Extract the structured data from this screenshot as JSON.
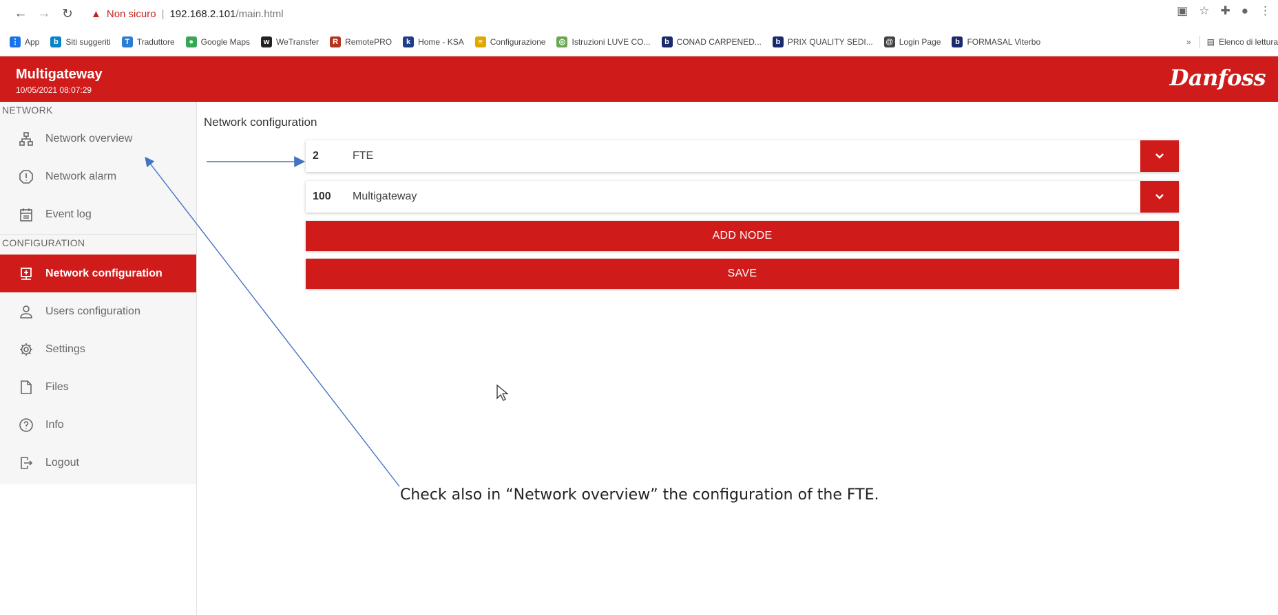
{
  "browser": {
    "security_label": "Non sicuro",
    "url_host": "192.168.2.101",
    "url_path": "/main.html",
    "bookmarks": [
      {
        "label": "App",
        "icon": "apps-grid-icon",
        "color": "#1a73e8"
      },
      {
        "label": "Siti suggeriti",
        "icon": "bing-icon",
        "color": "#0a84c4"
      },
      {
        "label": "Traduttore",
        "icon": "translator-icon",
        "color": "#2b7cd3"
      },
      {
        "label": "Google Maps",
        "icon": "maps-pin-icon",
        "color": "#34a853"
      },
      {
        "label": "WeTransfer",
        "icon": "wetransfer-icon",
        "color": "#222222"
      },
      {
        "label": "RemotePRO",
        "icon": "remotepro-icon",
        "color": "#b5361f"
      },
      {
        "label": "Home - KSA",
        "icon": "ksa-icon",
        "color": "#1f3e8a"
      },
      {
        "label": "Configurazione",
        "icon": "stack-icon",
        "color": "#e0a800"
      },
      {
        "label": "Istruzioni LUVE CO...",
        "icon": "globe-icon",
        "color": "#6aa84f"
      },
      {
        "label": "CONAD CARPENED...",
        "icon": "b-icon",
        "color": "#1a2a6c"
      },
      {
        "label": "PRIX QUALITY SEDI...",
        "icon": "b-icon",
        "color": "#1a2a6c"
      },
      {
        "label": "Login Page",
        "icon": "swirl-icon",
        "color": "#444444"
      },
      {
        "label": "FORMASAL Viterbo",
        "icon": "b-icon",
        "color": "#1a2a6c"
      }
    ],
    "more_label": "»",
    "reading_list_label": "Elenco di lettura"
  },
  "app": {
    "title": "Multigateway",
    "datetime": "10/05/2021 08:07:29",
    "brand": "Danfoss",
    "accent_color": "#d01b1b"
  },
  "sidebar": {
    "network_section": "NETWORK",
    "configuration_section": "CONFIGURATION",
    "items": [
      {
        "label": "Network overview",
        "icon": "network-topology-icon"
      },
      {
        "label": "Network alarm",
        "icon": "alarm-warning-icon"
      },
      {
        "label": "Event log",
        "icon": "event-log-icon"
      },
      {
        "label": "Network configuration",
        "icon": "network-config-icon",
        "active": true
      },
      {
        "label": "Users configuration",
        "icon": "user-icon"
      },
      {
        "label": "Settings",
        "icon": "gear-icon"
      },
      {
        "label": "Files",
        "icon": "file-icon"
      },
      {
        "label": "Info",
        "icon": "help-circle-icon"
      },
      {
        "label": "Logout",
        "icon": "logout-icon"
      }
    ]
  },
  "main": {
    "title": "Network configuration",
    "nodes": [
      {
        "id": "2",
        "name": "FTE"
      },
      {
        "id": "100",
        "name": "Multigateway"
      }
    ],
    "add_node_label": "ADD NODE",
    "save_label": "SAVE"
  },
  "annotation": {
    "text": "Check also in “Network overview” the configuration of the FTE."
  }
}
